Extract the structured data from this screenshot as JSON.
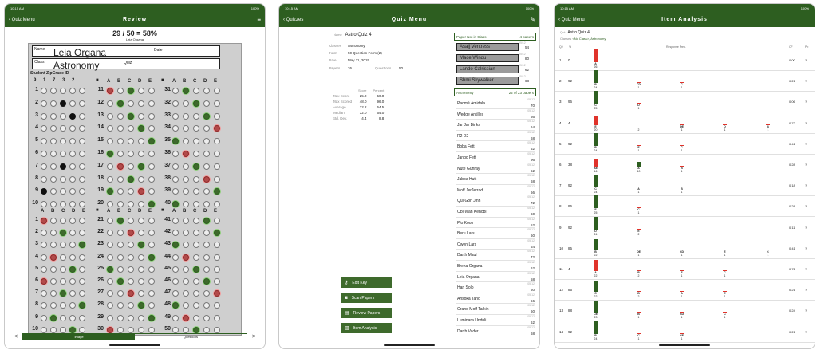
{
  "status": {
    "time": "10:15 AM",
    "date": "Wed Jun 19",
    "battery": "100%"
  },
  "review": {
    "back_label": "Quiz Menu",
    "title": "Review",
    "score": "29 / 50 = 58%",
    "student": "Leia Organa",
    "sheet": {
      "name_label": "Name",
      "name_value": "Leia Organa",
      "date_label": "Date",
      "class_label": "Class",
      "class_value": "Astronomy",
      "quiz_label": "Quiz",
      "id_label": "Student ZipGrade ID",
      "id_digits": [
        "9",
        "1",
        "7",
        "3",
        "2"
      ],
      "cols": [
        "A",
        "B",
        "C",
        "D",
        "E"
      ],
      "top_nums": [
        "1",
        "2",
        "3",
        "4",
        "5",
        "6",
        "7",
        "8",
        "9",
        "10"
      ],
      "mid_nums": [
        "11",
        "12",
        "13",
        "14",
        "15",
        "16",
        "17",
        "18",
        "19",
        "20"
      ],
      "right_nums": [
        "31",
        "32",
        "33",
        "34",
        "35",
        "36",
        "37",
        "38",
        "39",
        "40"
      ],
      "bot_nums": [
        "1",
        "2",
        "3",
        "4",
        "5",
        "6",
        "7",
        "8",
        "9",
        "10"
      ],
      "bot_mid": [
        "21",
        "22",
        "23",
        "24",
        "25",
        "26",
        "27",
        "28",
        "29",
        "30"
      ],
      "bot_right": [
        "41",
        "42",
        "43",
        "44",
        "45",
        "46",
        "47",
        "48",
        "49",
        "50"
      ]
    },
    "seg_image": "Image",
    "seg_questions": "Questions",
    "prev": "<",
    "next": ">"
  },
  "quizmenu": {
    "back_label": "Quizzes",
    "title": "Quiz Menu",
    "name_label": "Name",
    "quiz_name": "Astro Quiz 4",
    "fields": [
      {
        "k": "Classes",
        "v": "Astronomy"
      },
      {
        "k": "Form",
        "v": "50 Question Form (2)"
      },
      {
        "k": "Date",
        "v": "May 11, 2015"
      }
    ],
    "papers_label": "Papers",
    "papers": "26",
    "questions_label": "Questions",
    "questions": "50",
    "stats_headers": [
      "Score",
      "Percent"
    ],
    "stats": [
      {
        "k": "Max Score",
        "a": "25.0",
        "b": "50.0"
      },
      {
        "k": "Max Scored",
        "a": "48.0",
        "b": "96.0"
      },
      {
        "k": "Average",
        "a": "32.2",
        "b": "64.5"
      },
      {
        "k": "Median",
        "a": "32.0",
        "b": "64.0"
      },
      {
        "k": "Std. Dev.",
        "a": "4.4",
        "b": "8.8"
      }
    ],
    "not_in_class": {
      "label": "Paper Not in Class",
      "count": "4 papers"
    },
    "guests": [
      {
        "n": "Asajj Ventress",
        "d": "05/12",
        "v": "54"
      },
      {
        "n": "Mace Windu",
        "d": "05/12",
        "v": "80"
      },
      {
        "n": "Lando Calrissian",
        "d": "05/12",
        "v": "62"
      },
      {
        "n": "Shmi Skywalker",
        "d": "05/12",
        "v": "68"
      }
    ],
    "class": {
      "label": "Astronomy",
      "count": "22 of 23 papers"
    },
    "students": [
      {
        "n": "Padmé Amidala",
        "d": "05/12",
        "v": "70"
      },
      {
        "n": "Wedge Antilles",
        "d": "05/12",
        "v": "66"
      },
      {
        "n": "Jar Jar Binks",
        "d": "05/12",
        "v": "64"
      },
      {
        "n": "R2 D2",
        "d": "05/12",
        "v": "68"
      },
      {
        "n": "Boba Fett",
        "d": "05/12",
        "v": "52"
      },
      {
        "n": "Jango Fett",
        "d": "05/12",
        "v": "96"
      },
      {
        "n": "Nute Gunray",
        "d": "05/12",
        "v": "62"
      },
      {
        "n": "Jabba Hutt",
        "d": "05/12",
        "v": "68"
      },
      {
        "n": "Moff JerJerrod",
        "d": "05/12",
        "v": "66"
      },
      {
        "n": "Qui-Gon Jinn",
        "d": "05/12",
        "v": "72"
      },
      {
        "n": "Obi-Wan Kenobi",
        "d": "05/12",
        "v": "60"
      },
      {
        "n": "Plo Koon",
        "d": "05/12",
        "v": "52"
      },
      {
        "n": "Beru Lars",
        "d": "05/12",
        "v": "60"
      },
      {
        "n": "Owen Lars",
        "d": "05/12",
        "v": "64"
      },
      {
        "n": "Darth Maul",
        "d": "05/12",
        "v": "72"
      },
      {
        "n": "Breha Organa",
        "d": "05/12",
        "v": "62"
      },
      {
        "n": "Leia Organa",
        "d": "05/12",
        "v": "58"
      },
      {
        "n": "Han Solo",
        "d": "05/12",
        "v": "60"
      },
      {
        "n": "Ahsoka Tano",
        "d": "05/12",
        "v": "66"
      },
      {
        "n": "Grand Moff Tarkin",
        "d": "05/12",
        "v": "60"
      },
      {
        "n": "Luminara Unduli",
        "d": "05/12",
        "v": "62"
      },
      {
        "n": "Darth Vader",
        "d": "05/12",
        "v": "68"
      }
    ],
    "buttons": [
      {
        "label": "Edit Key",
        "icon": "key-icon",
        "g": "⚷"
      },
      {
        "label": "Scan Papers",
        "icon": "camera-icon",
        "g": "◙"
      },
      {
        "label": "Review Papers",
        "icon": "review-icon",
        "g": "▤"
      },
      {
        "label": "Item Analysis",
        "icon": "chart-icon",
        "g": "▥"
      }
    ]
  },
  "itemanalysis": {
    "back_label": "Quiz Menu",
    "title": "Item Analysis",
    "quiz_label": "Quiz",
    "quiz": "Astro Quiz 4",
    "classes_label": "Classes",
    "classes": "<No Class>, Astronomy",
    "headers": {
      "q": "Q#",
      "pct": "%",
      "resp": "Response Freq.",
      "cf": "CF",
      "pb": "Pb"
    },
    "rows": [
      {
        "q": "1",
        "p": "0",
        "cf": "0.00",
        "pb": "?",
        "r": [
          {
            "l": "A",
            "c": "26",
            "h": 16,
            "k": "rd"
          }
        ]
      },
      {
        "q": "2",
        "p": "92",
        "cf": "0.21",
        "pb": "?",
        "r": [
          {
            "l": "B",
            "c": "24",
            "h": 16,
            "k": "gr"
          },
          {
            "l": "CD",
            "c": "1",
            "h": 1,
            "k": "rd"
          },
          {
            "l": "C",
            "c": "1",
            "h": 1,
            "k": "rd"
          }
        ]
      },
      {
        "q": "3",
        "p": "96",
        "cf": "0.06",
        "pb": "?",
        "r": [
          {
            "l": "C",
            "c": "25",
            "h": 16,
            "k": "gr"
          },
          {
            "l": "D",
            "c": "1",
            "h": 1,
            "k": "rd"
          }
        ]
      },
      {
        "q": "4",
        "p": "4",
        "cf": "0.72",
        "pb": "?",
        "r": [
          {
            "l": "E",
            "c": "20",
            "h": 12,
            "k": "rd"
          },
          {
            "l": "",
            "c": "2",
            "h": 1,
            "k": "rd"
          },
          {
            "l": "DE",
            "c": "1",
            "h": 1,
            "k": "rd"
          },
          {
            "l": "D",
            "c": "1",
            "h": 1,
            "k": "rd"
          },
          {
            "l": "B",
            "c": "1",
            "h": 1,
            "k": "rd"
          }
        ]
      },
      {
        "q": "5",
        "p": "92",
        "cf": "0.41",
        "pb": "?",
        "r": [
          {
            "l": "B",
            "c": "24",
            "h": 16,
            "k": "gr"
          },
          {
            "l": "E",
            "c": "1",
            "h": 1,
            "k": "rd"
          },
          {
            "l": "C",
            "c": "1",
            "h": 1,
            "k": "rd"
          }
        ]
      },
      {
        "q": "6",
        "p": "38",
        "cf": "0.28",
        "pb": "?",
        "r": [
          {
            "l": "AE",
            "c": "16",
            "h": 10,
            "k": "rd"
          },
          {
            "l": "A",
            "c": "10",
            "h": 6,
            "k": "gr"
          },
          {
            "l": "B",
            "c": "1",
            "h": 1,
            "k": "rd"
          }
        ]
      },
      {
        "q": "7",
        "p": "92",
        "cf": "0.18",
        "pb": "?",
        "r": [
          {
            "l": "C",
            "c": "24",
            "h": 16,
            "k": "gr"
          },
          {
            "l": "A",
            "c": "1",
            "h": 1,
            "k": "rd"
          },
          {
            "l": "B",
            "c": "1",
            "h": 1,
            "k": "rd"
          }
        ]
      },
      {
        "q": "8",
        "p": "96",
        "cf": "0.28",
        "pb": "?",
        "r": [
          {
            "l": "E",
            "c": "25",
            "h": 16,
            "k": "gr"
          },
          {
            "l": "C",
            "c": "1",
            "h": 1,
            "k": "rd"
          }
        ]
      },
      {
        "q": "9",
        "p": "92",
        "cf": "0.11",
        "pb": "?",
        "r": [
          {
            "l": "D",
            "c": "24",
            "h": 16,
            "k": "gr"
          },
          {
            "l": "E",
            "c": "2",
            "h": 1,
            "k": "rd"
          }
        ]
      },
      {
        "q": "10",
        "p": "85",
        "cf": "0.41",
        "pb": "?",
        "r": [
          {
            "l": "B",
            "c": "22",
            "h": 14,
            "k": "gr"
          },
          {
            "l": "DE",
            "c": "1",
            "h": 1,
            "k": "rd"
          },
          {
            "l": "CD",
            "c": "1",
            "h": 1,
            "k": "rd"
          },
          {
            "l": "E",
            "c": "1",
            "h": 1,
            "k": "rd"
          },
          {
            "l": "C",
            "c": "1",
            "h": 1,
            "k": "rd"
          }
        ]
      },
      {
        "q": "11",
        "p": "4",
        "cf": "0.72",
        "pb": "?",
        "r": [
          {
            "l": "A",
            "c": "22",
            "h": 14,
            "k": "rd"
          },
          {
            "l": "B",
            "c": "2",
            "h": 1,
            "k": "rd"
          },
          {
            "l": "E",
            "c": "1",
            "h": 1,
            "k": "rd"
          },
          {
            "l": "C",
            "c": "1",
            "h": 1,
            "k": "rd"
          }
        ]
      },
      {
        "q": "12",
        "p": "85",
        "cf": "0.21",
        "pb": "?",
        "r": [
          {
            "l": "C",
            "c": "22",
            "h": 14,
            "k": "gr"
          },
          {
            "l": "B",
            "c": "2",
            "h": 1,
            "k": "rd"
          },
          {
            "l": "A",
            "c": "1",
            "h": 1,
            "k": "rd"
          },
          {
            "l": "E",
            "c": "1",
            "h": 1,
            "k": "rd"
          }
        ]
      },
      {
        "q": "13",
        "p": "88",
        "cf": "0.24",
        "pb": "?",
        "r": [
          {
            "l": "CE",
            "c": "23",
            "h": 15,
            "k": "gr"
          },
          {
            "l": "B",
            "c": "1",
            "h": 1,
            "k": "rd"
          },
          {
            "l": "CD",
            "c": "1",
            "h": 1,
            "k": "rd"
          },
          {
            "l": "C",
            "c": "1",
            "h": 1,
            "k": "rd"
          }
        ]
      },
      {
        "q": "14",
        "p": "92",
        "cf": "0.21",
        "pb": "?",
        "r": [
          {
            "l": "B",
            "c": "24",
            "h": 16,
            "k": "gr"
          },
          {
            "l": "C",
            "c": "1",
            "h": 1,
            "k": "rd"
          },
          {
            "l": "CE",
            "c": "1",
            "h": 1,
            "k": "rd"
          }
        ]
      }
    ]
  },
  "colors": {
    "brand": "#2d5e20",
    "correct": "#2d5e20",
    "wrong": "#e0332b"
  }
}
